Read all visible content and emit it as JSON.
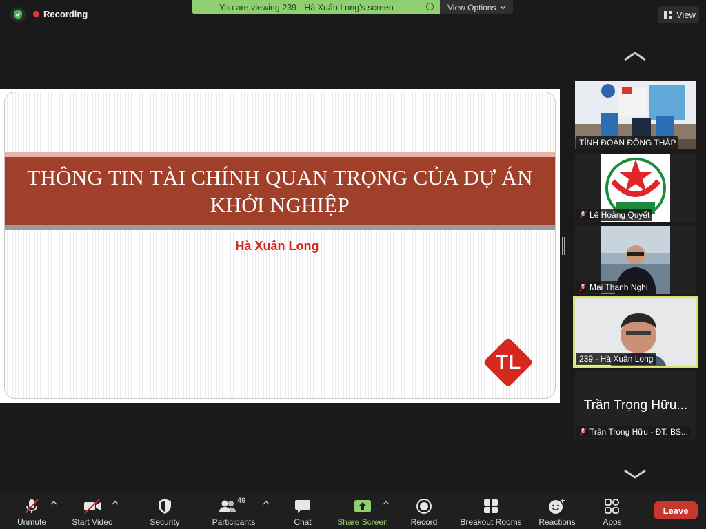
{
  "topbar": {
    "recording_label": "Recording",
    "viewing_banner": "You are viewing 239 - Hà Xuân Long's screen",
    "view_options_label": "View Options",
    "view_label": "View"
  },
  "slide": {
    "title_line1": "THÔNG TIN TÀI CHÍNH QUAN TRỌNG CỦA DỰ ÁN",
    "title_line2": "KHỞI NGHIỆP",
    "presenter": "Hà Xuân Long",
    "logo_text": "TL",
    "logo_color": "#d6281e",
    "band_color": "#a0402b"
  },
  "gallery": {
    "participants": [
      {
        "name": "TỈNH ĐOÀN ĐỒNG THÁP",
        "muted": false,
        "video": true
      },
      {
        "name": "Lê Hoàng Quyết",
        "muted": true,
        "video": true
      },
      {
        "name": "Mai Thanh Nghị",
        "muted": true,
        "video": true
      },
      {
        "name": "239 - Hà Xuân Long",
        "muted": false,
        "video": true,
        "active": true
      },
      {
        "name": "Trần Trọng Hữu - ĐT. BS...",
        "display_name": "Trần Trọng Hữu...",
        "muted": true,
        "video": false
      }
    ],
    "active_border_color": "#d7e36d"
  },
  "toolbar": {
    "unmute": "Unmute",
    "start_video": "Start Video",
    "security": "Security",
    "participants": "Participants",
    "participants_count": "49",
    "chat": "Chat",
    "share_screen": "Share Screen",
    "record": "Record",
    "breakout_rooms": "Breakout Rooms",
    "reactions": "Reactions",
    "apps": "Apps",
    "leave": "Leave",
    "share_color": "#8ed06f",
    "leave_color": "#c7372f"
  }
}
